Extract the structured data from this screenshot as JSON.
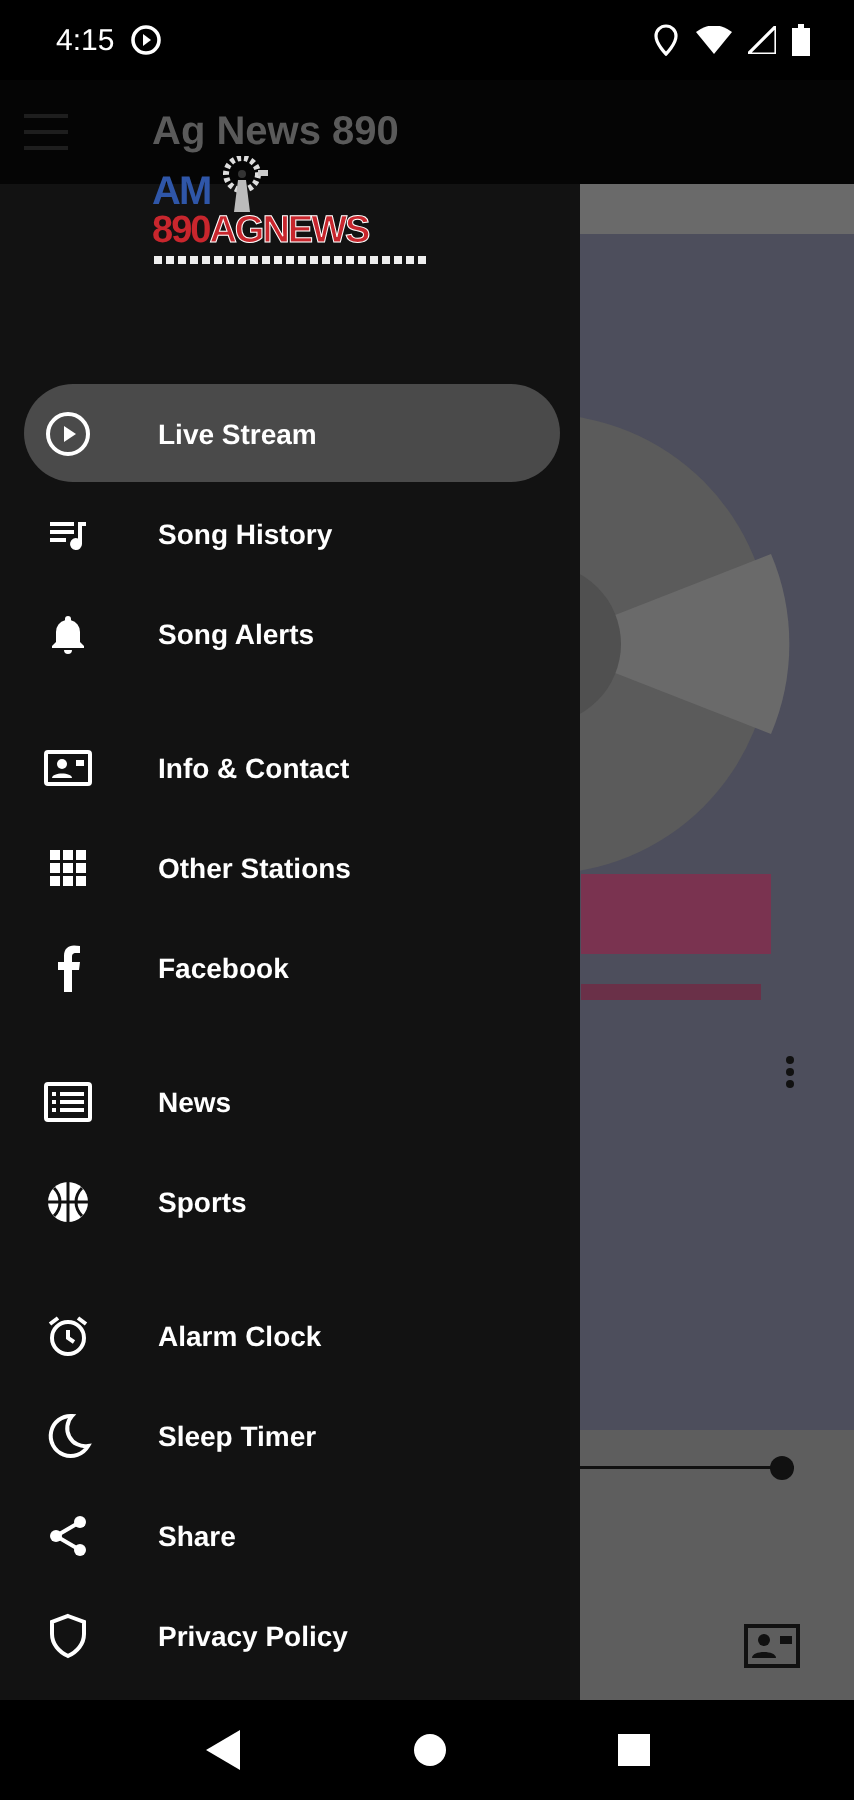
{
  "status_bar": {
    "time": "4:15"
  },
  "app_bar": {
    "title": "Ag News 890"
  },
  "drawer": {
    "logo": {
      "line_1": "AM",
      "line_2": "890",
      "line_3": "AGNEWS"
    },
    "groups": [
      {
        "items": [
          {
            "label": "Live Stream",
            "selected": true
          },
          {
            "label": "Song History",
            "selected": false
          },
          {
            "label": "Song Alerts",
            "selected": false
          }
        ]
      },
      {
        "items": [
          {
            "label": "Info & Contact",
            "selected": false
          },
          {
            "label": "Other Stations",
            "selected": false
          },
          {
            "label": "Facebook",
            "selected": false
          }
        ]
      },
      {
        "items": [
          {
            "label": "News",
            "selected": false
          },
          {
            "label": "Sports",
            "selected": false
          }
        ]
      },
      {
        "items": [
          {
            "label": "Alarm Clock",
            "selected": false
          },
          {
            "label": "Sleep Timer",
            "selected": false
          },
          {
            "label": "Share",
            "selected": false
          },
          {
            "label": "Privacy Policy",
            "selected": false
          }
        ]
      }
    ]
  },
  "player": {
    "volume": {
      "level": 0.97
    }
  }
}
